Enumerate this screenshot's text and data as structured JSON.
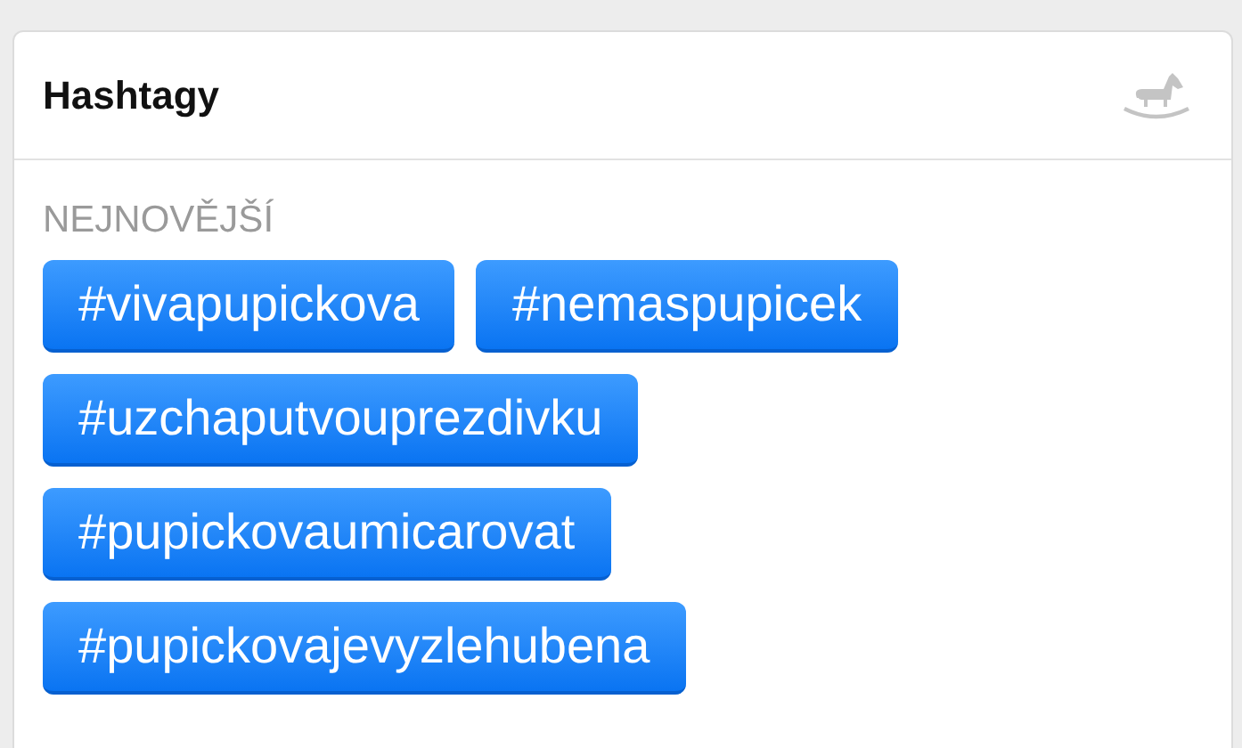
{
  "card": {
    "title": "Hashtagy",
    "section_label": "NEJNOVĚJŠÍ",
    "tags": [
      "#vivapupickova",
      "#nemaspupicek",
      "#uzchaputvouprezdivku",
      "#pupickovaumicarovat",
      "#pupickovajevyzlehubena"
    ]
  }
}
